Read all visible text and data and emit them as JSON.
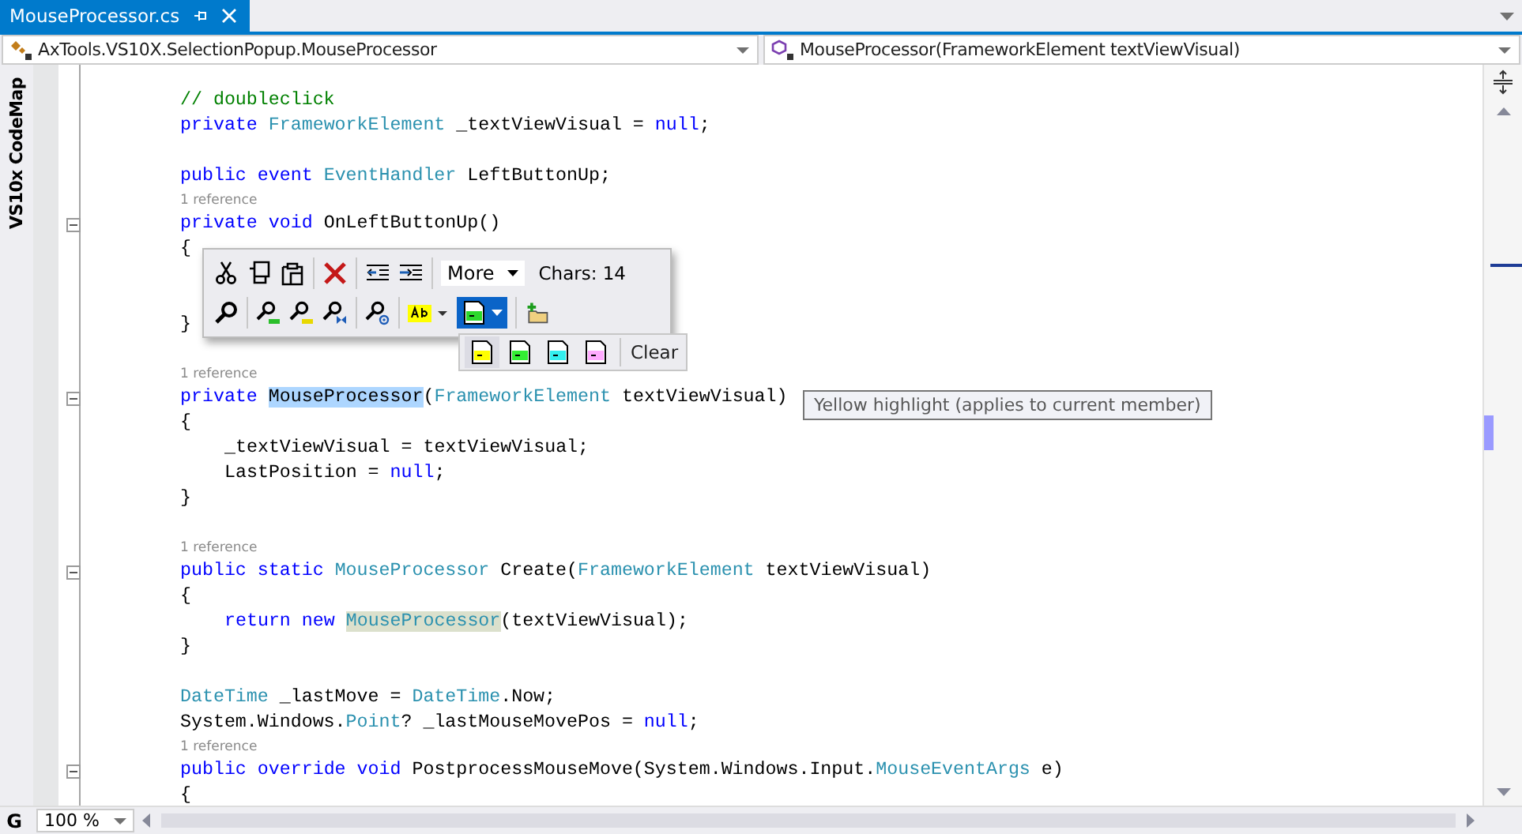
{
  "tab": {
    "title": "MouseProcessor.cs",
    "selected": true
  },
  "nav": {
    "type_combo": "AxTools.VS10X.SelectionPopup.MouseProcessor",
    "member_combo": "MouseProcessor(FrameworkElement textViewVisual)"
  },
  "side_tab": "VS10x CodeMap",
  "lines": [
    {
      "kind": "code",
      "fold": false,
      "tokens": [
        {
          "text": "// doubleclick",
          "kind": "comment"
        }
      ]
    },
    {
      "kind": "code",
      "fold": false,
      "tokens": [
        {
          "text": "private ",
          "kind": "kw"
        },
        {
          "text": "FrameworkElement",
          "kind": "type"
        },
        {
          "text": " _textViewVisual = ",
          "kind": "plain"
        },
        {
          "text": "null",
          "kind": "kw"
        },
        {
          "text": ";",
          "kind": "plain"
        }
      ]
    },
    {
      "kind": "blank"
    },
    {
      "kind": "code",
      "fold": false,
      "tokens": [
        {
          "text": "public ",
          "kind": "kw"
        },
        {
          "text": "event ",
          "kind": "kw"
        },
        {
          "text": "EventHandler",
          "kind": "type"
        },
        {
          "text": " LeftButtonUp;",
          "kind": "plain"
        }
      ]
    },
    {
      "kind": "ref",
      "text": "1 reference"
    },
    {
      "kind": "code",
      "fold": true,
      "tokens": [
        {
          "text": "private ",
          "kind": "kw"
        },
        {
          "text": "void ",
          "kind": "kw"
        },
        {
          "text": "OnLeftButtonUp()",
          "kind": "plain"
        }
      ]
    },
    {
      "kind": "code",
      "fold": false,
      "tokens": [
        {
          "text": "{",
          "kind": "plain"
        }
      ]
    },
    {
      "kind": "blank"
    },
    {
      "kind": "blank"
    },
    {
      "kind": "code",
      "fold": false,
      "tokens": [
        {
          "text": "}",
          "kind": "plain"
        }
      ]
    },
    {
      "kind": "blank"
    },
    {
      "kind": "ref",
      "text": "1 reference"
    },
    {
      "kind": "code",
      "fold": true,
      "tokens": [
        {
          "text": "private ",
          "kind": "kw"
        },
        {
          "text": "MouseProcessor",
          "kind": "selected"
        },
        {
          "text": "(",
          "kind": "plain"
        },
        {
          "text": "FrameworkElement",
          "kind": "type"
        },
        {
          "text": " textViewVisual)",
          "kind": "plain"
        }
      ]
    },
    {
      "kind": "code",
      "fold": false,
      "tokens": [
        {
          "text": "{",
          "kind": "plain"
        }
      ]
    },
    {
      "kind": "block",
      "children": [
        {
          "fold": false,
          "tokens": [
            {
              "text": "_textViewVisual = textViewVisual;",
              "kind": "plain"
            }
          ]
        },
        {
          "fold": false,
          "tokens": [
            {
              "text": "LastPosition = ",
              "kind": "plain"
            },
            {
              "text": "null",
              "kind": "kw"
            },
            {
              "text": ";",
              "kind": "plain"
            }
          ]
        }
      ]
    },
    {
      "kind": "code",
      "fold": false,
      "tokens": [
        {
          "text": "}",
          "kind": "plain"
        }
      ]
    },
    {
      "kind": "blank"
    },
    {
      "kind": "ref",
      "text": "1 reference"
    },
    {
      "kind": "code",
      "fold": true,
      "tokens": [
        {
          "text": "public ",
          "kind": "kw"
        },
        {
          "text": "static ",
          "kind": "kw"
        },
        {
          "text": "MouseProcessor",
          "kind": "type"
        },
        {
          "text": " Create(",
          "kind": "plain"
        },
        {
          "text": "FrameworkElement",
          "kind": "type"
        },
        {
          "text": " textViewVisual)",
          "kind": "plain"
        }
      ]
    },
    {
      "kind": "code",
      "fold": false,
      "tokens": [
        {
          "text": "{",
          "kind": "plain"
        }
      ]
    },
    {
      "kind": "block",
      "children": [
        {
          "fold": false,
          "tokens": [
            {
              "text": "return ",
              "kind": "kw"
            },
            {
              "text": "new ",
              "kind": "kw"
            },
            {
              "text": "MouseProcessor",
              "kind": "reference"
            },
            {
              "text": "(textViewVisual);",
              "kind": "plain"
            }
          ]
        }
      ]
    },
    {
      "kind": "code",
      "fold": false,
      "tokens": [
        {
          "text": "}",
          "kind": "plain"
        }
      ]
    },
    {
      "kind": "blank"
    },
    {
      "kind": "code",
      "fold": false,
      "tokens": [
        {
          "text": "DateTime",
          "kind": "type"
        },
        {
          "text": " _lastMove = ",
          "kind": "plain"
        },
        {
          "text": "DateTime",
          "kind": "type"
        },
        {
          "text": ".Now;",
          "kind": "plain"
        }
      ]
    },
    {
      "kind": "code",
      "fold": false,
      "tokens": [
        {
          "text": "System.Windows.",
          "kind": "plain"
        },
        {
          "text": "Point",
          "kind": "type"
        },
        {
          "text": "? _lastMouseMovePos = ",
          "kind": "plain"
        },
        {
          "text": "null",
          "kind": "kw"
        },
        {
          "text": ";",
          "kind": "plain"
        }
      ]
    },
    {
      "kind": "ref",
      "text": "1 reference"
    },
    {
      "kind": "code",
      "fold": true,
      "tokens": [
        {
          "text": "public ",
          "kind": "kw"
        },
        {
          "text": "override ",
          "kind": "kw"
        },
        {
          "text": "void ",
          "kind": "kw"
        },
        {
          "text": "PostprocessMouseMove(System.Windows.Input.",
          "kind": "plain"
        },
        {
          "text": "MouseEventArgs",
          "kind": "type"
        },
        {
          "text": " e)",
          "kind": "plain"
        }
      ]
    },
    {
      "kind": "code",
      "fold": false,
      "tokens": [
        {
          "text": "{",
          "kind": "plain"
        }
      ]
    }
  ],
  "popup": {
    "more": "More",
    "chars": "Chars: 14",
    "note_button": {
      "selected": true
    },
    "note_colors": [
      {
        "color": "#ffff00",
        "selected": true
      },
      {
        "color": "#33ee33",
        "selected": false
      },
      {
        "color": "#33eeee",
        "selected": false
      },
      {
        "color": "#ffaaff",
        "selected": false
      }
    ],
    "clear": "Clear"
  },
  "tooltip": "Yellow highlight (applies to current member)",
  "status": {
    "marker": "G",
    "zoom": "100 %"
  }
}
